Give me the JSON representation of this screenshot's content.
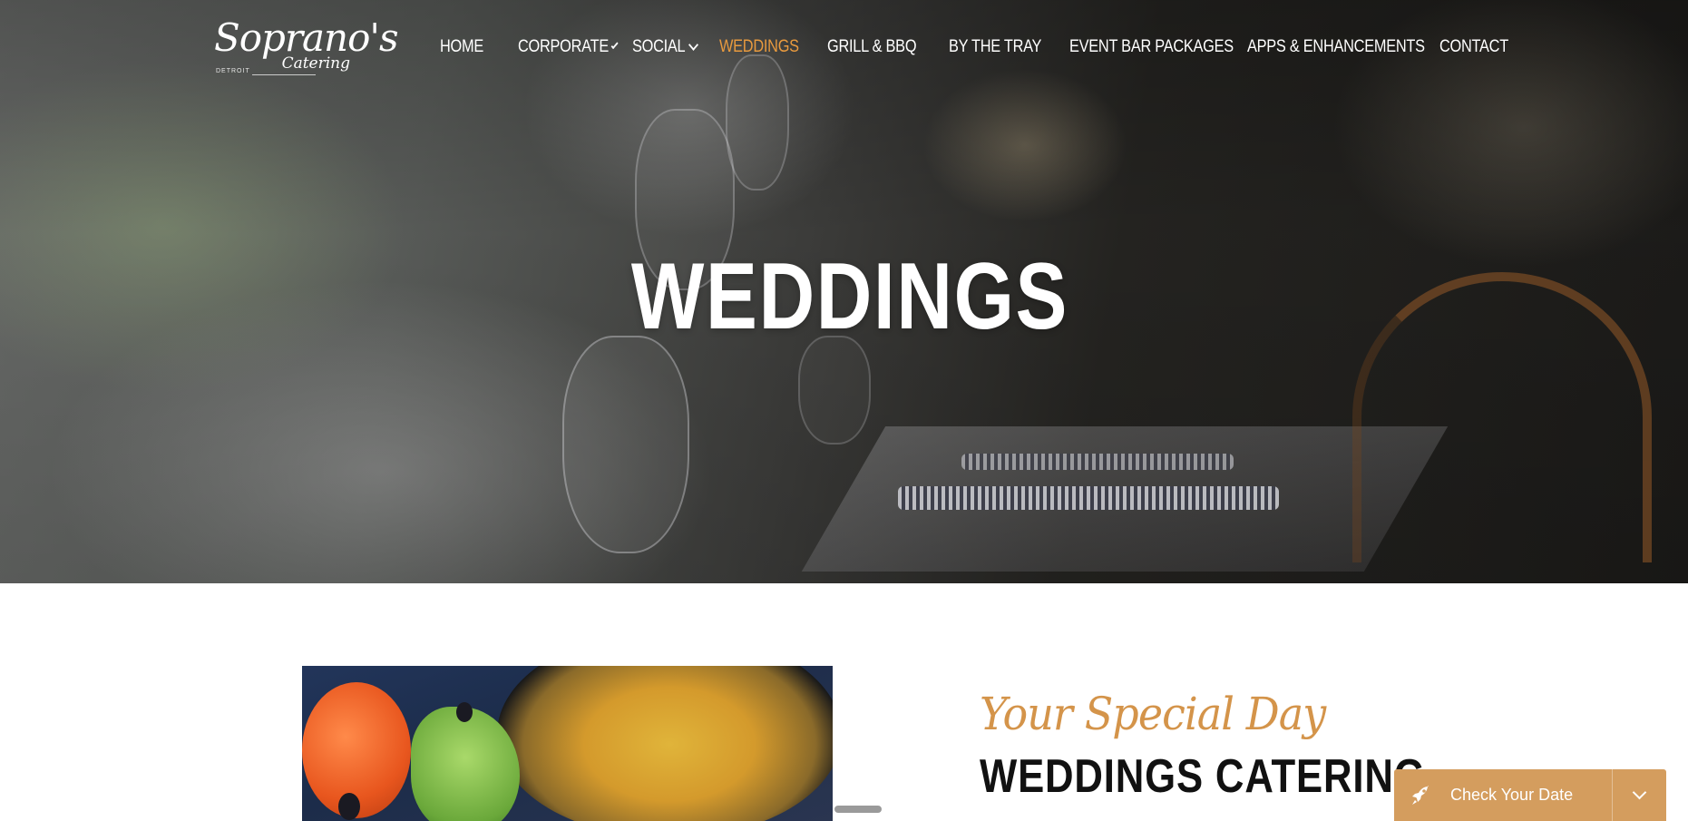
{
  "brand": {
    "name": "Soprano's",
    "sub": "Catering",
    "city": "DETROIT"
  },
  "nav": {
    "items": [
      {
        "label": "HOME",
        "dropdown": false,
        "active": false
      },
      {
        "label": "CORPORATE",
        "dropdown": true,
        "active": false
      },
      {
        "label": "SOCIAL",
        "dropdown": true,
        "active": false
      },
      {
        "label": "WEDDINGS",
        "dropdown": false,
        "active": true
      },
      {
        "label": "GRILL & BBQ",
        "dropdown": false,
        "active": false
      },
      {
        "label": "BY THE TRAY",
        "dropdown": false,
        "active": false
      },
      {
        "label": "EVENT BAR PACKAGES",
        "dropdown": false,
        "active": false
      },
      {
        "label": "APPS & ENHANCEMENTS",
        "dropdown": false,
        "active": false
      },
      {
        "label": "CONTACT",
        "dropdown": false,
        "active": false
      }
    ]
  },
  "hero": {
    "title": "WEDDINGS"
  },
  "intro": {
    "script_heading": "Your Special Day",
    "heading": "WEDDINGS CATERING"
  },
  "widget": {
    "label": "Check Your Date",
    "icon": "rocket-icon",
    "toggle_icon": "chevron-down-icon"
  },
  "colors": {
    "accent": "#e89a3e",
    "script": "#d4944a",
    "widget_bg": "#d49d5e",
    "heading": "#111111"
  }
}
